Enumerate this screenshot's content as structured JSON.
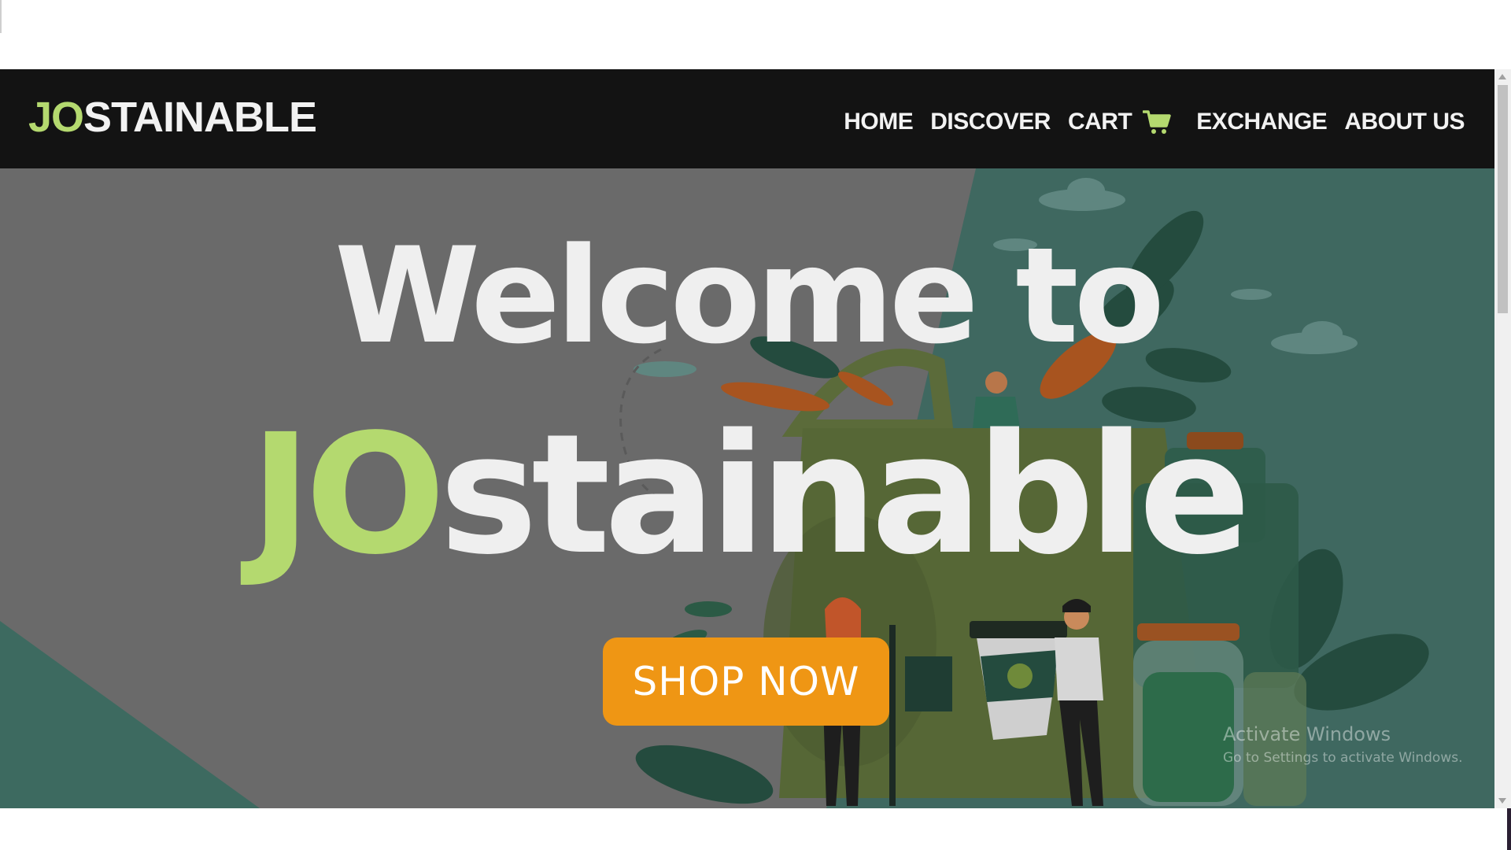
{
  "brand": {
    "prefix": "JO",
    "rest": "STAINABLE",
    "accent": "#b4d96f"
  },
  "nav": {
    "items": [
      {
        "label": "HOME"
      },
      {
        "label": "DISCOVER"
      },
      {
        "label": "CART",
        "icon": "shopping-cart-icon"
      },
      {
        "label": "EXCHANGE"
      },
      {
        "label": "ABOUT US"
      }
    ]
  },
  "hero": {
    "line1": "Welcome to",
    "line2_prefix": "JO",
    "line2_rest": "stainable",
    "cta_label": "SHOP NOW",
    "cta_color": "#ef9614",
    "illustration": "eco-shopping-bag-illustration"
  },
  "watermark": {
    "title": "Activate Windows",
    "subtitle": "Go to Settings to activate Windows."
  }
}
